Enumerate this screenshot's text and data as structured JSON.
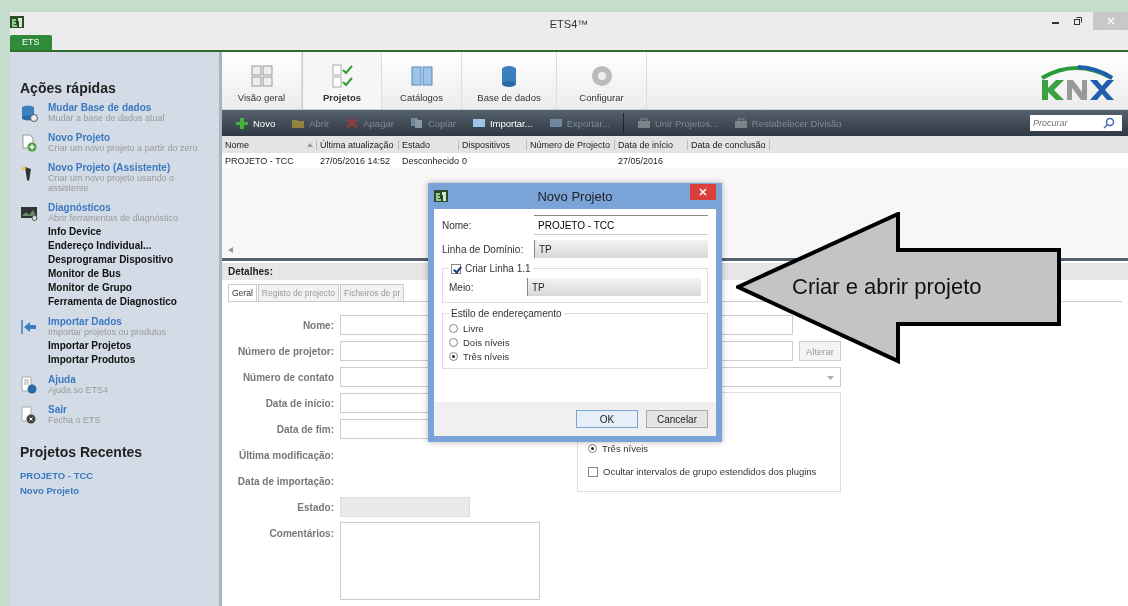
{
  "window": {
    "title": "ETS4™",
    "app_tab": "ETS"
  },
  "sidebar": {
    "title": "Ações rápidas",
    "actions": [
      {
        "title": "Mudar Base de dados",
        "description": "Mudar a base de dados atual"
      },
      {
        "title": "Novo Projeto",
        "description": "Criar um novo projeto a partir do zero"
      },
      {
        "title": "Novo Projeto (Assistente)",
        "description": "Criar um novo projeto usando o assistente"
      },
      {
        "title": "Diagnósticos",
        "description": "Abrir ferramentas de diagnóstico",
        "links": [
          "Info Device",
          "Endereço Individual...",
          "Desprogramar Dispositivo",
          "Monitor de Bus",
          "Monitor de Grupo",
          "Ferramenta de Diagnostico"
        ]
      },
      {
        "title": "Importar Dados",
        "description": "Importar projetos ou produtos",
        "links": [
          "Importar Projetos",
          "Importar Produtos"
        ]
      },
      {
        "title": "Ajuda",
        "description": "Ajuda so ETS4"
      },
      {
        "title": "Sair",
        "description": "Fecha o ETS"
      }
    ],
    "recent_title": "Projetos Recentes",
    "recent": [
      "PROJETO - TCC",
      "Novo Projeto"
    ]
  },
  "ribbon": {
    "tabs": [
      {
        "label": "Visão geral",
        "selected": false
      },
      {
        "label": "Projetos",
        "selected": true
      },
      {
        "label": "Catálogos",
        "selected": false
      },
      {
        "label": "Base de dados",
        "selected": false
      },
      {
        "label": "Configurar",
        "selected": false
      }
    ]
  },
  "toolbar": {
    "buttons": [
      {
        "label": "Novo",
        "disabled": false
      },
      {
        "label": "Abrir",
        "disabled": true
      },
      {
        "label": "Apagar",
        "disabled": true
      },
      {
        "label": "Copiar",
        "disabled": true
      },
      {
        "label": "Importar...",
        "disabled": false
      },
      {
        "label": "Exportar...",
        "disabled": true
      },
      {
        "label": "Unir Projetos...",
        "disabled": true
      },
      {
        "label": "Restabelecer Divisão",
        "disabled": true
      }
    ],
    "search": {
      "placeholder": "Procurar"
    }
  },
  "table": {
    "columns": [
      "Nome",
      "Última atualização",
      "Estado",
      "Dispositivos",
      "Número de Projecto",
      "Data de início",
      "Data de conclusão"
    ],
    "rows": [
      {
        "cells": [
          "PROJETO - TCC",
          "27/05/2016 14:52",
          "Desconhecido",
          "0",
          null,
          "27/05/2016",
          null
        ]
      }
    ]
  },
  "details": {
    "title": "Detalhes:",
    "tabs": [
      {
        "label": "Geral",
        "selected": true
      },
      {
        "label": "Registo de projecto",
        "selected": false
      },
      {
        "label": "Ficheiros de pr",
        "selected": false
      }
    ],
    "fields": [
      {
        "label": "Nome:",
        "kind": "text"
      },
      {
        "label": "Número de projetor:",
        "kind": "text",
        "button": "Alterar"
      },
      {
        "label": "Número de contato",
        "kind": "select"
      },
      {
        "label": "Data de início:",
        "kind": "date"
      },
      {
        "label": "Data de fim:",
        "kind": "date"
      },
      {
        "label": "Última modificação:",
        "kind": "info"
      },
      {
        "label": "Data de importação:",
        "kind": "info"
      },
      {
        "label": "Estado:",
        "kind": "locked"
      },
      {
        "label": "Comentários:",
        "kind": "textarea"
      }
    ],
    "addressing": {
      "options": [
        {
          "label": "Três níveis",
          "selected": true
        }
      ],
      "hide_ranges": {
        "label": "Ocultar intervalos de grupo estendidos dos plugins",
        "checked": false
      }
    }
  },
  "dialog": {
    "title": "Novo Projeto",
    "name_label": "Nome:",
    "name_value": "PROJETO - TCC",
    "domain_label": "Linha de Domínio:",
    "domain_value": "TP",
    "create_line": {
      "label": "Criar Linha 1.1",
      "checked": true
    },
    "medium_label": "Meio:",
    "medium_value": "TP",
    "addressing": {
      "title": "Estilo de endereçamento",
      "options": [
        {
          "label": "Livre",
          "selected": false
        },
        {
          "label": "Dois níveis",
          "selected": false
        },
        {
          "label": "Três níveis",
          "selected": true
        }
      ]
    },
    "buttons": [
      "OK",
      "Cancelar"
    ]
  },
  "callout": {
    "text": "Criar e abrir projeto"
  }
}
